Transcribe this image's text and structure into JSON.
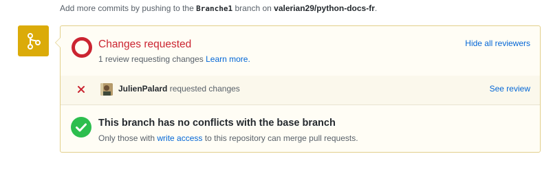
{
  "note": {
    "prefix": "Add more commits by pushing to the",
    "branch": "Branche1",
    "middle": "branch on",
    "repo": "valerian29/python-docs-fr",
    "suffix": "."
  },
  "icons": {
    "merge": "git-merge-icon",
    "changes": "changes-requested-ring-icon",
    "reviewer_status": "x-icon",
    "conflicts": "check-circle-icon"
  },
  "colors": {
    "badge": "#dbab09",
    "changes_red": "#cb2431",
    "success_green": "#2cbe4e",
    "link_blue": "#0366d6"
  },
  "changes_requested": {
    "title": "Changes requested",
    "summary": "1 review requesting changes",
    "learn_more": "Learn more.",
    "hide_reviewers": "Hide all reviewers"
  },
  "review": {
    "user": "JulienPalard",
    "action": "requested changes",
    "see_review": "See review"
  },
  "conflicts": {
    "title": "This branch has no conflicts with the base branch",
    "prefix": "Only those with",
    "link": "write access",
    "suffix": "to this repository can merge pull requests."
  }
}
